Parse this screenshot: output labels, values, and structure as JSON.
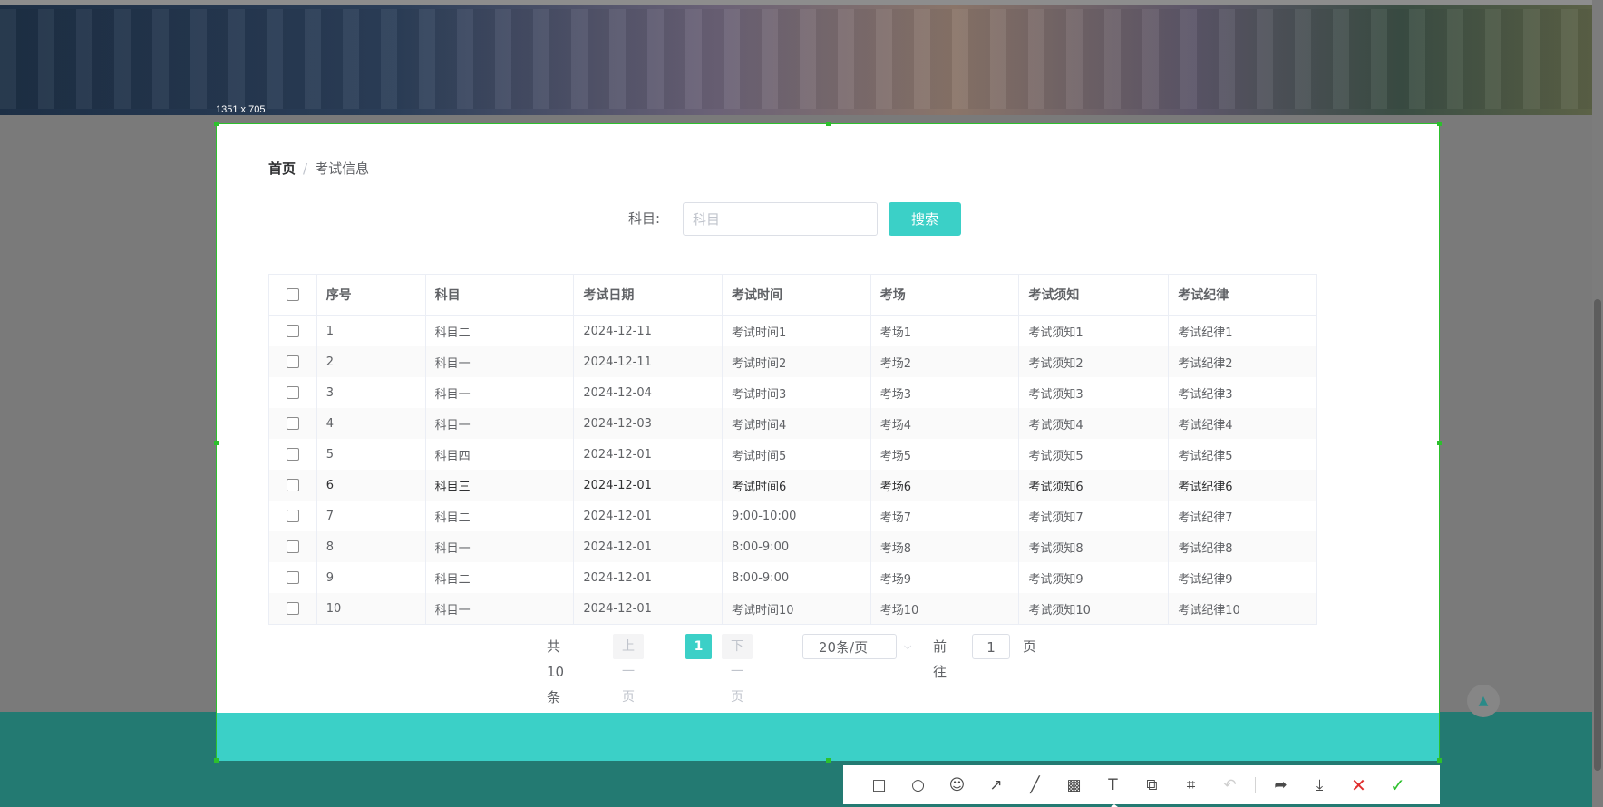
{
  "selection": {
    "size_label": "1351 x 705"
  },
  "breadcrumb": {
    "home": "首页",
    "separator": "/",
    "current": "考试信息"
  },
  "search": {
    "label": "科目:",
    "placeholder": "科目",
    "value": "",
    "button_label": "搜索"
  },
  "table": {
    "headers": [
      "序号",
      "科目",
      "考试日期",
      "考试时间",
      "考场",
      "考试须知",
      "考试纪律"
    ],
    "rows": [
      [
        "1",
        "科目二",
        "2024-12-11",
        "考试时间1",
        "考场1",
        "考试须知1",
        "考试纪律1"
      ],
      [
        "2",
        "科目一",
        "2024-12-11",
        "考试时间2",
        "考场2",
        "考试须知2",
        "考试纪律2"
      ],
      [
        "3",
        "科目一",
        "2024-12-04",
        "考试时间3",
        "考场3",
        "考试须知3",
        "考试纪律3"
      ],
      [
        "4",
        "科目一",
        "2024-12-03",
        "考试时间4",
        "考场4",
        "考试须知4",
        "考试纪律4"
      ],
      [
        "5",
        "科目四",
        "2024-12-01",
        "考试时间5",
        "考场5",
        "考试须知5",
        "考试纪律5"
      ],
      [
        "6",
        "科目三",
        "2024-12-01",
        "考试时间6",
        "考场6",
        "考试须知6",
        "考试纪律6"
      ],
      [
        "7",
        "科目二",
        "2024-12-01",
        "9:00-10:00",
        "考场7",
        "考试须知7",
        "考试纪律7"
      ],
      [
        "8",
        "科目一",
        "2024-12-01",
        "8:00-9:00",
        "考场8",
        "考试须知8",
        "考试纪律8"
      ],
      [
        "9",
        "科目二",
        "2024-12-01",
        "8:00-9:00",
        "考场9",
        "考试须知9",
        "考试纪律9"
      ],
      [
        "10",
        "科目一",
        "2024-12-01",
        "考试时间10",
        "考场10",
        "考试须知10",
        "考试纪律10"
      ]
    ]
  },
  "pagination": {
    "total": "共 10 条",
    "prev": "上一页",
    "current_page": "1",
    "next": "下一页",
    "page_size": "20条/页",
    "goto_label": "前往",
    "goto_value": "1",
    "goto_unit": "页"
  },
  "toolbar": {
    "tools": [
      {
        "name": "rectangle-tool",
        "glyph": "□"
      },
      {
        "name": "ellipse-tool",
        "glyph": "○"
      },
      {
        "name": "emoji-tool",
        "glyph": "☺"
      },
      {
        "name": "arrow-tool",
        "glyph": "↗"
      },
      {
        "name": "line-tool",
        "glyph": "╱"
      },
      {
        "name": "mosaic-tool",
        "glyph": "▩"
      },
      {
        "name": "text-tool",
        "glyph": "T"
      },
      {
        "name": "pin-tool",
        "glyph": "⧉"
      },
      {
        "name": "ocr-tool",
        "glyph": "⌗"
      },
      {
        "name": "undo-tool",
        "glyph": "↶"
      }
    ],
    "actions": [
      {
        "name": "share-tool",
        "glyph": "➦"
      },
      {
        "name": "save-tool",
        "glyph": "⤓"
      },
      {
        "name": "cancel-tool",
        "glyph": "✕"
      },
      {
        "name": "confirm-tool",
        "glyph": "✓"
      }
    ]
  },
  "colors": {
    "accent": "#3bd0c7",
    "selection_border": "#2dc02d",
    "footer": "#237a72"
  }
}
